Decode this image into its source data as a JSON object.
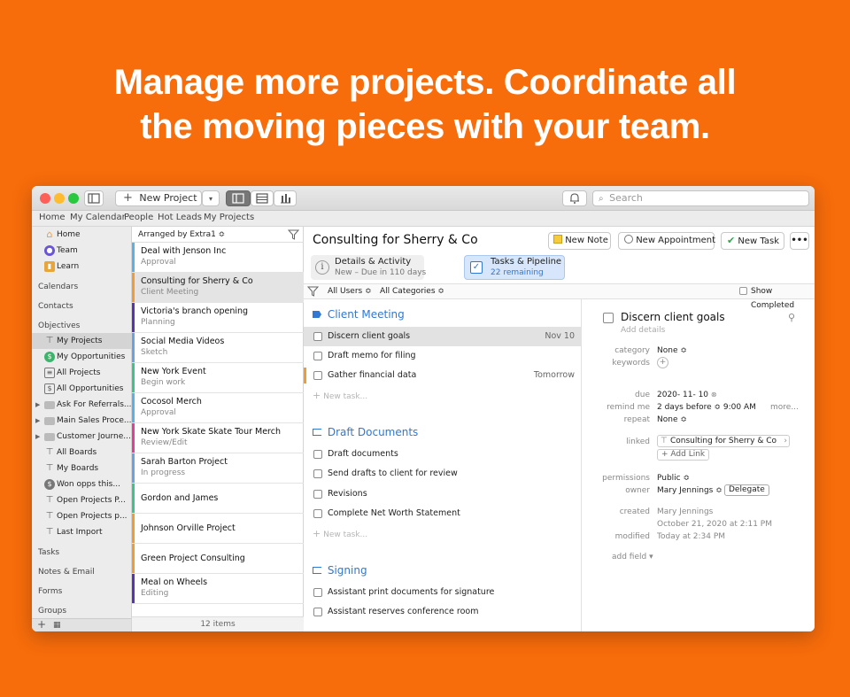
{
  "headline": {
    "line1": "Manage more projects. Coordinate all",
    "line2": "the moving pieces with your team."
  },
  "colors": {
    "background": "#f76c0b",
    "accent": "#2f78d4"
  },
  "toolbar": {
    "new_project": "New Project",
    "search_placeholder": "Search"
  },
  "navbar": [
    "Home",
    "My Calendar",
    "People",
    "Hot Leads",
    "My Projects"
  ],
  "sidebar": {
    "top": [
      {
        "label": "Home",
        "icon": "home-icon"
      },
      {
        "label": "Team",
        "icon": "team-icon"
      },
      {
        "label": "Learn",
        "icon": "learn-icon"
      }
    ],
    "headers": {
      "calendars": "Calendars",
      "contacts": "Contacts",
      "objectives": "Objectives",
      "tasks": "Tasks",
      "notes": "Notes & Email",
      "forms": "Forms",
      "groups": "Groups"
    },
    "objectives": [
      "My Projects",
      "My Opportunities",
      "All Projects",
      "All Opportunities",
      "Ask For Referrals...",
      "Main Sales Proce...",
      "Customer Journe...",
      "All Boards",
      "My Boards",
      "Won opps this...",
      "Open Projects P...",
      "Open Projects p...",
      "Last Import"
    ]
  },
  "list": {
    "arranged_by": "Arranged by Extra1 ≎",
    "items": [
      {
        "title": "Deal with Jenson Inc",
        "sub": "Approval",
        "color": "#5ab0e8"
      },
      {
        "title": "Consulting for Sherry & Co",
        "sub": "Client Meeting",
        "color": "#f29a36"
      },
      {
        "title": "Victoria's branch opening",
        "sub": "Planning",
        "color": "#5a33b0"
      },
      {
        "title": "Social Media Videos",
        "sub": "Sketch",
        "color": "#6aa2e6"
      },
      {
        "title": "New York Event",
        "sub": "Begin work",
        "color": "#3ec48b"
      },
      {
        "title": "Cocosol Merch",
        "sub": "Approval",
        "color": "#5ab0e8"
      },
      {
        "title": "New York Skate Skate Tour Merch",
        "sub": "Review/Edit",
        "color": "#e33f98"
      },
      {
        "title": "Sarah Barton Project",
        "sub": "In progress",
        "color": "#6aa2e6"
      },
      {
        "title": "Gordon and James",
        "sub": "",
        "color": "#3ec48b"
      },
      {
        "title": "Johnson Orville Project",
        "sub": "",
        "color": "#f29a36"
      },
      {
        "title": "Green Project Consulting",
        "sub": "",
        "color": "#f29a36"
      },
      {
        "title": "Meal on Wheels",
        "sub": "Editing",
        "color": "#5a33b0"
      }
    ],
    "footer": "12 items"
  },
  "main": {
    "title": "Consulting for Sherry & Co",
    "new_note": "New Note",
    "new_appointment": "New Appointment",
    "new_task": "New Task",
    "tab_details": {
      "title": "Details & Activity",
      "sub": "New – Due in 110 days"
    },
    "tab_tasks": {
      "title": "Tasks & Pipeline",
      "sub": "22 remaining"
    },
    "filter_users": "All Users ≎",
    "filter_categories": "All Categories ≎",
    "show_completed": "Show Completed"
  },
  "tasks": {
    "group1": "Client Meeting",
    "group1_items": [
      {
        "label": "Discern client goals",
        "due": "Nov 10"
      },
      {
        "label": "Draft memo for filing",
        "due": ""
      },
      {
        "label": "Gather financial data",
        "due": "Tomorrow"
      }
    ],
    "group2": "Draft Documents",
    "group2_items": [
      {
        "label": "Draft documents"
      },
      {
        "label": "Send drafts to client for review"
      },
      {
        "label": "Revisions"
      },
      {
        "label": "Complete Net Worth Statement"
      }
    ],
    "group3": "Signing",
    "group3_items": [
      {
        "label": "Assistant print documents for signature"
      },
      {
        "label": "Assistant reserves conference room"
      }
    ],
    "new_task": "New task..."
  },
  "detail": {
    "title": "Discern client goals",
    "add_details": "Add details",
    "category_label": "category",
    "category_value": "None ≎",
    "keywords_label": "keywords",
    "due_label": "due",
    "due_value": "2020- 11- 10",
    "remind_label": "remind me",
    "remind_value": "2   days before ≎   9:00 AM",
    "remind_more": "more...",
    "repeat_label": "repeat",
    "repeat_value": "None ≎",
    "linked_label": "linked",
    "linked_value": "Consulting for Sherry & Co",
    "add_link": "Add Link",
    "permissions_label": "permissions",
    "permissions_value": "Public ≎",
    "owner_label": "owner",
    "owner_value": "Mary Jennings ≎",
    "delegate": "Delegate",
    "created_label": "created",
    "created_by": "Mary Jennings",
    "created_date": "October 21, 2020 at 2:11 PM",
    "modified_label": "modified",
    "modified_value": "Today at 2:34 PM",
    "add_field": "add field ▾"
  }
}
